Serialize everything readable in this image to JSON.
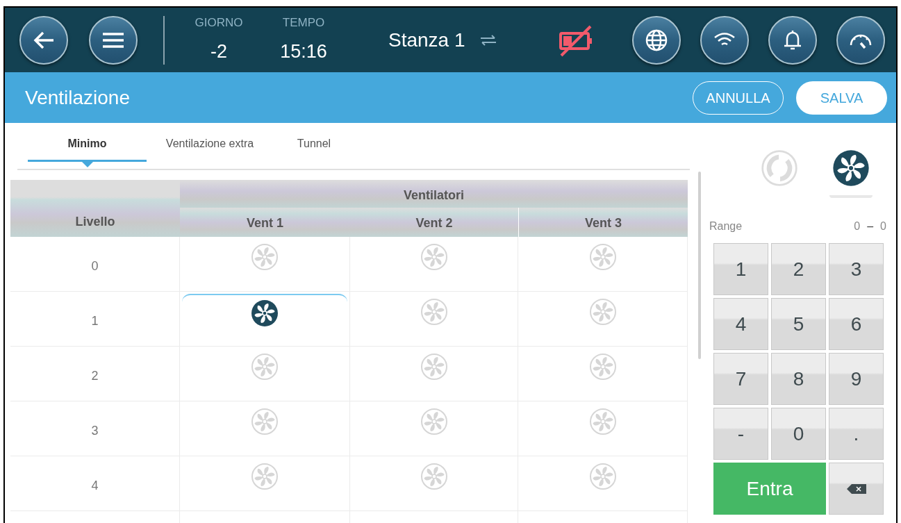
{
  "header": {
    "day": {
      "label": "GIORNO",
      "value": "-2"
    },
    "time": {
      "label": "TEMPO",
      "value": "15:16"
    },
    "room": "Stanza 1",
    "battery_alarm": true
  },
  "title_bar": {
    "title": "Ventilazione",
    "buttons": [
      {
        "kind": "outline",
        "label": "ANNULLA"
      },
      {
        "kind": "filled",
        "label": "SALVA"
      }
    ]
  },
  "tabs": [
    {
      "label": "Minimo",
      "selected": true
    },
    {
      "label": "Ventilazione extra",
      "selected": false
    },
    {
      "label": "Tunnel",
      "selected": false
    }
  ],
  "table": {
    "group_header": "Ventilatori",
    "level_header": "Livello",
    "columns": [
      "Vent 1",
      "Vent 2",
      "Vent 3"
    ],
    "rows": [
      {
        "level": "0",
        "cells": [
          {
            "on": false,
            "selected": false
          },
          {
            "on": false,
            "selected": false
          },
          {
            "on": false,
            "selected": false
          }
        ]
      },
      {
        "level": "1",
        "cells": [
          {
            "on": true,
            "selected": true
          },
          {
            "on": false,
            "selected": false
          },
          {
            "on": false,
            "selected": false
          }
        ]
      },
      {
        "level": "2",
        "cells": [
          {
            "on": false,
            "selected": false
          },
          {
            "on": false,
            "selected": false
          },
          {
            "on": false,
            "selected": false
          }
        ]
      },
      {
        "level": "3",
        "cells": [
          {
            "on": false,
            "selected": false
          },
          {
            "on": false,
            "selected": false
          },
          {
            "on": false,
            "selected": false
          }
        ]
      },
      {
        "level": "4",
        "cells": [
          {
            "on": false,
            "selected": false
          },
          {
            "on": false,
            "selected": false
          },
          {
            "on": false,
            "selected": false
          }
        ]
      }
    ]
  },
  "modes": [
    {
      "kind": "auto",
      "selected": false
    },
    {
      "kind": "fan",
      "selected": true
    }
  ],
  "range": {
    "label": "Range",
    "min": "0",
    "separator": "–",
    "max": "0"
  },
  "keypad": [
    {
      "kind": "digit",
      "label": "1"
    },
    {
      "kind": "digit",
      "label": "2"
    },
    {
      "kind": "digit",
      "label": "3"
    },
    {
      "kind": "digit",
      "label": "4"
    },
    {
      "kind": "digit",
      "label": "5"
    },
    {
      "kind": "digit",
      "label": "6"
    },
    {
      "kind": "digit",
      "label": "7"
    },
    {
      "kind": "digit",
      "label": "8"
    },
    {
      "kind": "digit",
      "label": "9"
    },
    {
      "kind": "digit",
      "label": "-"
    },
    {
      "kind": "digit",
      "label": "0"
    },
    {
      "kind": "digit",
      "label": "."
    },
    {
      "kind": "enter",
      "label": "Entra"
    },
    {
      "kind": "backspace"
    }
  ]
}
